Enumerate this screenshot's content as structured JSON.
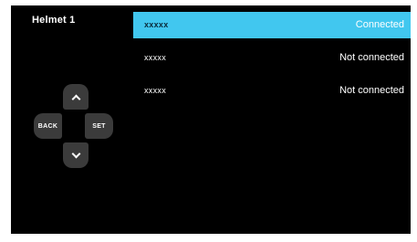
{
  "header": {
    "title": "Helmet 1"
  },
  "controls": {
    "back_label": "BACK",
    "set_label": "SET",
    "up_icon": "chevron-up-icon",
    "down_icon": "chevron-down-icon"
  },
  "devices": [
    {
      "name": "xxxxx",
      "status": "Connected",
      "selected": true
    },
    {
      "name": "xxxxx",
      "status": "Not connected",
      "selected": false
    },
    {
      "name": "xxxxx",
      "status": "Not connected",
      "selected": false
    }
  ],
  "colors": {
    "background": "#000000",
    "highlight": "#41c7ef",
    "button": "#3b3b3b",
    "text": "#ffffff"
  }
}
